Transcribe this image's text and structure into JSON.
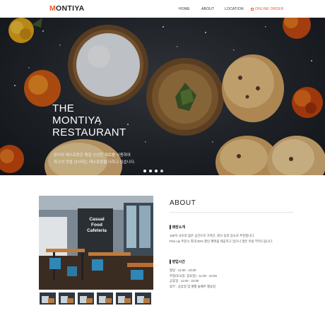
{
  "header": {
    "logo_first": "M",
    "logo_rest": "ONTIYA",
    "nav": [
      "HOME",
      "ABOUT",
      "LOCATION",
      "ONLINE ORDER"
    ]
  },
  "hero": {
    "title_lines": [
      "THE",
      "MONTIYA",
      "RESTAURANT"
    ],
    "description_lines": [
      "몬티아 레스토랑은 매일 신선한 재료를 사용하여",
      "최고의 맛을 선사하는 레스토랑을 다하고 있습니다."
    ],
    "slider": {
      "count": 4,
      "active_index": 3
    }
  },
  "about": {
    "title": "ABOUT",
    "photo_sign": [
      "Casual",
      "Food",
      "Cafeteria"
    ],
    "thumbnail_count": 6,
    "sections": [
      {
        "heading": "매장소개",
        "lines": [
          "150석 규모의 넓은 공간으로 가족단, 회식 등의 장소로 추천합니다.",
          "Pick Up 주문시 최대 30% 할인 혜택을 제공하고 있으니 많은 이용 부탁드립니다."
        ]
      },
      {
        "heading": "영업시간",
        "lines": [
          "평일 : 12:00 - 23:00",
          "주말(토요일, 일요일) : 11:00 - 24:00",
          "공휴일 : 11:00 - 24:00",
          "휴무 : 공휴일 및 매월 둘째주 월요일"
        ]
      }
    ]
  },
  "colors": {
    "accent": "#e8572a",
    "hero_bg": "#22262c"
  }
}
